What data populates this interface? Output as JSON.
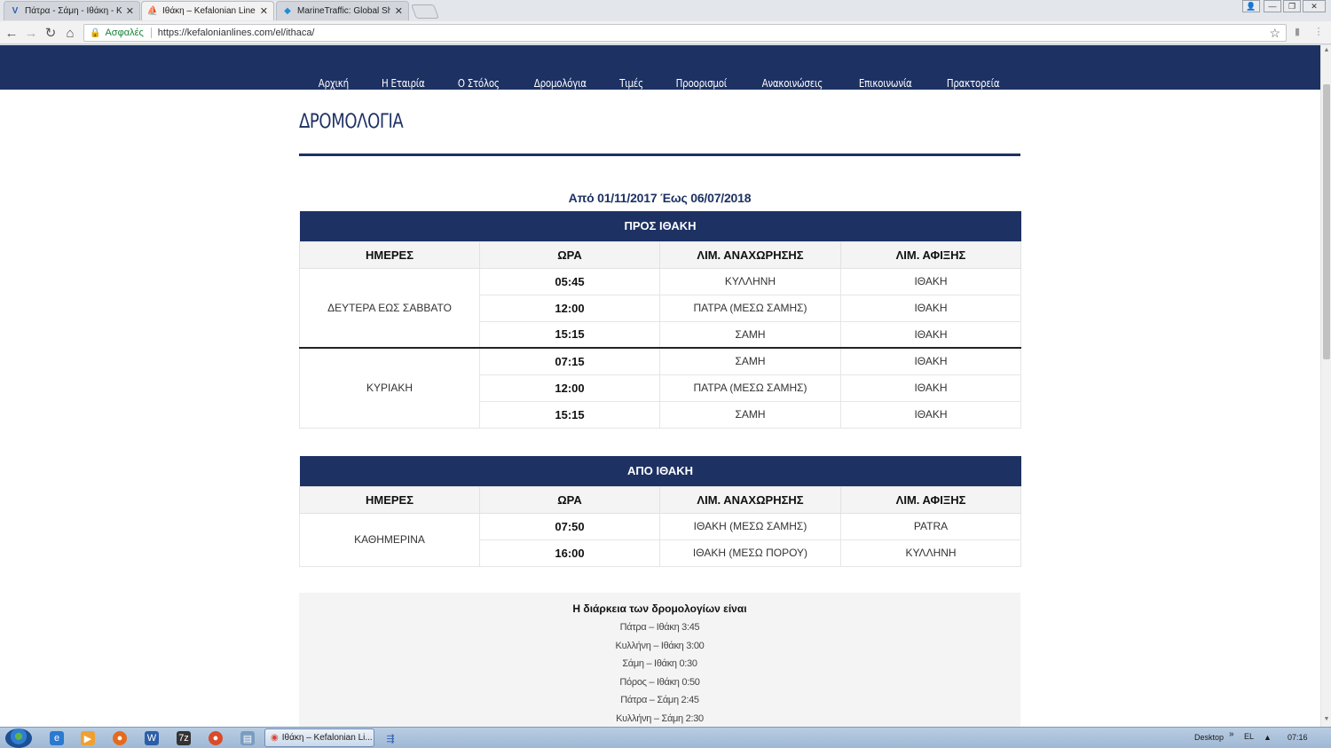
{
  "browser": {
    "tabs": [
      {
        "label": "Πάτρα - Σάμη - Ιθάκη - Κ",
        "icon": "site-v-icon",
        "active": false
      },
      {
        "label": "Ιθάκη – Kefalonian Lines",
        "icon": "ship-logo-icon",
        "active": true
      },
      {
        "label": "MarineTraffic: Global Ship",
        "icon": "marinetraffic-icon",
        "active": false
      }
    ],
    "address": {
      "secure_label": "Ασφαλές",
      "url": "https://kefalonianlines.com/el/ithaca/"
    }
  },
  "site": {
    "nav": [
      "Αρχική",
      "Η Εταιρία",
      "Ο Στόλος",
      "Δρομολόγια",
      "Τιμές",
      "Προορισμοί",
      "Ανακοινώσεις",
      "Επικοινωνία",
      "Πρακτορεία"
    ],
    "page_title": "ΔΡΟΜΟΛΟΓΙΑ",
    "period": "Από 01/11/2017 Έως 06/07/2018",
    "headers": {
      "days": "ΗΜΕΡΕΣ",
      "time": "ΩΡΑ",
      "departure": "ΛΙΜ. ΑΝΑΧΩΡΗΣΗΣ",
      "arrival": "ΛΙΜ. ΑΦΙΞΗΣ"
    },
    "to_ithaca": {
      "caption": "ΠΡΟΣ ΙΘΑΚΗ",
      "groups": [
        {
          "days": "ΔΕΥΤΕΡΑ ΕΩΣ ΣΑΒΒΑΤΟ",
          "rows": [
            {
              "time": "05:45",
              "from": "ΚΥΛΛΗΝΗ",
              "to": "ΙΘΑΚΗ"
            },
            {
              "time": "12:00",
              "from": "ΠΑΤΡΑ (ΜΕΣΩ ΣΑΜΗΣ)",
              "to": "ΙΘΑΚΗ"
            },
            {
              "time": "15:15",
              "from": "ΣΑΜΗ",
              "to": "ΙΘΑΚΗ"
            }
          ]
        },
        {
          "days": "ΚΥΡΙΑΚΗ",
          "rows": [
            {
              "time": "07:15",
              "from": "ΣΑΜΗ",
              "to": "ΙΘΑΚΗ"
            },
            {
              "time": "12:00",
              "from": "ΠΑΤΡΑ (ΜΕΣΩ ΣΑΜΗΣ)",
              "to": "ΙΘΑΚΗ"
            },
            {
              "time": "15:15",
              "from": "ΣΑΜΗ",
              "to": "ΙΘΑΚΗ"
            }
          ]
        }
      ]
    },
    "from_ithaca": {
      "caption": "ΑΠΟ ΙΘΑΚΗ",
      "groups": [
        {
          "days": "ΚΑΘΗΜΕΡΙΝΑ",
          "rows": [
            {
              "time": "07:50",
              "from": "ΙΘΑΚΗ (ΜΕΣΩ ΣΑΜΗΣ)",
              "to": "PATRA"
            },
            {
              "time": "16:00",
              "from": "ΙΘΑΚΗ (ΜΕΣΩ ΠΟΡΟΥ)",
              "to": "ΚΥΛΛΗΝΗ"
            }
          ]
        }
      ]
    },
    "durations": {
      "heading": "Η διάρκεια των δρομολογίων είναι",
      "lines": [
        "Πάτρα – Ιθάκη 3:45",
        "Κυλλήνη – Ιθάκη 3:00",
        "Σάμη – Ιθάκη 0:30",
        "Πόρος – Ιθάκη 0:50",
        "Πάτρα – Σάμη 2:45",
        "Κυλλήνη – Σάμη 2:30"
      ]
    }
  },
  "taskbar": {
    "active_task": "Ιθάκη – Kefalonian Li...",
    "desktop_label": "Desktop",
    "language": "EL",
    "clock": "07:16"
  },
  "colors": {
    "brand_navy": "#1d3163"
  }
}
